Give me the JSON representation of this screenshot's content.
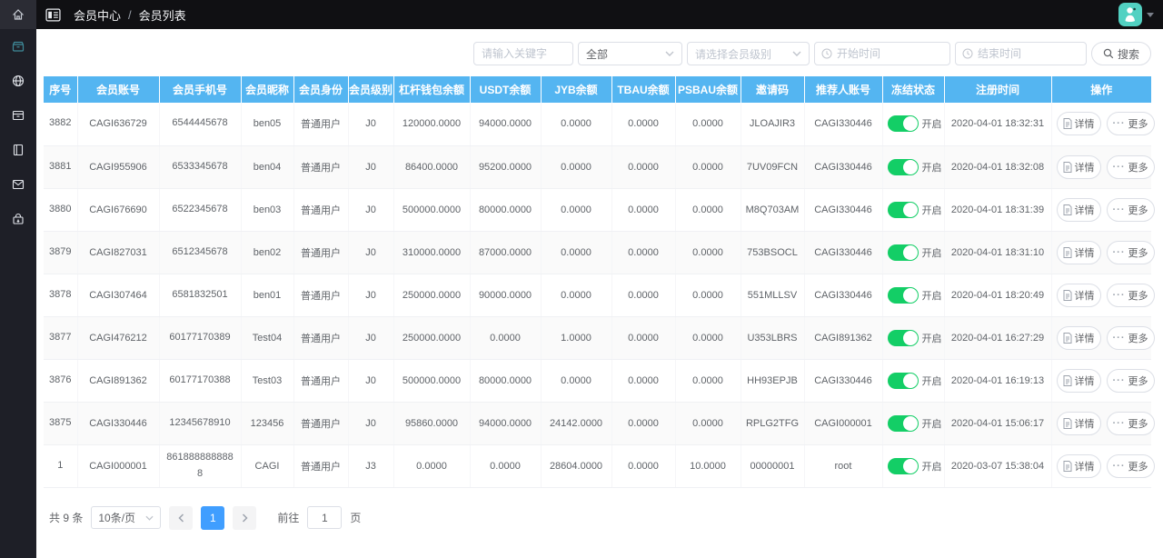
{
  "breadcrumb": {
    "section": "会员中心",
    "separator": "/",
    "current": "会员列表"
  },
  "sidebar": {
    "logo_icon": "home",
    "items": [
      {
        "icon": "member-box",
        "active": true
      },
      {
        "icon": "globe",
        "active": false
      },
      {
        "icon": "archive",
        "active": false
      },
      {
        "icon": "notebook",
        "active": false
      },
      {
        "icon": "mail",
        "active": false
      },
      {
        "icon": "package",
        "active": false
      }
    ]
  },
  "filters": {
    "keyword_placeholder": "请输入关键字",
    "scope_value": "全部",
    "level_placeholder": "请选择会员级别",
    "start_placeholder": "开始时间",
    "end_placeholder": "结束时间",
    "search_label": "搜索"
  },
  "table": {
    "headers": [
      "序号",
      "会员账号",
      "会员手机号",
      "会员昵称",
      "会员身份",
      "会员级别",
      "杠杆钱包余额",
      "USDT余额",
      "JYB余额",
      "TBAU余额",
      "PSBAU余额",
      "邀请码",
      "推荐人账号",
      "冻结状态",
      "注册时间",
      "操作"
    ],
    "actions": {
      "detail": "详情",
      "more": "更多"
    },
    "rows": [
      {
        "no": "3882",
        "account": "CAGI636729",
        "phone": "6544445678",
        "nickname": "ben05",
        "identity": "普通用户",
        "level": "J0",
        "wallet": "120000.0000",
        "usdt": "94000.0000",
        "jyb": "0.0000",
        "tbau": "0.0000",
        "psbau": "0.0000",
        "invite": "JLOAJIR3",
        "referrer": "CAGI330446",
        "freeze": "开启",
        "registered": "2020-04-01 18:32:31"
      },
      {
        "no": "3881",
        "account": "CAGI955906",
        "phone": "6533345678",
        "nickname": "ben04",
        "identity": "普通用户",
        "level": "J0",
        "wallet": "86400.0000",
        "usdt": "95200.0000",
        "jyb": "0.0000",
        "tbau": "0.0000",
        "psbau": "0.0000",
        "invite": "7UV09FCN",
        "referrer": "CAGI330446",
        "freeze": "开启",
        "registered": "2020-04-01 18:32:08"
      },
      {
        "no": "3880",
        "account": "CAGI676690",
        "phone": "6522345678",
        "nickname": "ben03",
        "identity": "普通用户",
        "level": "J0",
        "wallet": "500000.0000",
        "usdt": "80000.0000",
        "jyb": "0.0000",
        "tbau": "0.0000",
        "psbau": "0.0000",
        "invite": "M8Q703AM",
        "referrer": "CAGI330446",
        "freeze": "开启",
        "registered": "2020-04-01 18:31:39"
      },
      {
        "no": "3879",
        "account": "CAGI827031",
        "phone": "6512345678",
        "nickname": "ben02",
        "identity": "普通用户",
        "level": "J0",
        "wallet": "310000.0000",
        "usdt": "87000.0000",
        "jyb": "0.0000",
        "tbau": "0.0000",
        "psbau": "0.0000",
        "invite": "753BSOCL",
        "referrer": "CAGI330446",
        "freeze": "开启",
        "registered": "2020-04-01 18:31:10"
      },
      {
        "no": "3878",
        "account": "CAGI307464",
        "phone": "6581832501",
        "nickname": "ben01",
        "identity": "普通用户",
        "level": "J0",
        "wallet": "250000.0000",
        "usdt": "90000.0000",
        "jyb": "0.0000",
        "tbau": "0.0000",
        "psbau": "0.0000",
        "invite": "551MLLSV",
        "referrer": "CAGI330446",
        "freeze": "开启",
        "registered": "2020-04-01 18:20:49"
      },
      {
        "no": "3877",
        "account": "CAGI476212",
        "phone": "60177170389",
        "nickname": "Test04",
        "identity": "普通用户",
        "level": "J0",
        "wallet": "250000.0000",
        "usdt": "0.0000",
        "jyb": "1.0000",
        "tbau": "0.0000",
        "psbau": "0.0000",
        "invite": "U353LBRS",
        "referrer": "CAGI891362",
        "freeze": "开启",
        "registered": "2020-04-01 16:27:29"
      },
      {
        "no": "3876",
        "account": "CAGI891362",
        "phone": "60177170388",
        "nickname": "Test03",
        "identity": "普通用户",
        "level": "J0",
        "wallet": "500000.0000",
        "usdt": "80000.0000",
        "jyb": "0.0000",
        "tbau": "0.0000",
        "psbau": "0.0000",
        "invite": "HH93EPJB",
        "referrer": "CAGI330446",
        "freeze": "开启",
        "registered": "2020-04-01 16:19:13"
      },
      {
        "no": "3875",
        "account": "CAGI330446",
        "phone": "12345678910",
        "nickname": "123456",
        "identity": "普通用户",
        "level": "J0",
        "wallet": "95860.0000",
        "usdt": "94000.0000",
        "jyb": "24142.0000",
        "tbau": "0.0000",
        "psbau": "0.0000",
        "invite": "RPLG2TFG",
        "referrer": "CAGI000001",
        "freeze": "开启",
        "registered": "2020-04-01 15:06:17"
      },
      {
        "no": "1",
        "account": "CAGI000001",
        "phone": "8618888888888",
        "nickname": "CAGI",
        "identity": "普通用户",
        "level": "J3",
        "wallet": "0.0000",
        "usdt": "0.0000",
        "jyb": "28604.0000",
        "tbau": "0.0000",
        "psbau": "10.0000",
        "invite": "00000001",
        "referrer": "root",
        "freeze": "开启",
        "registered": "2020-03-07 15:38:04"
      }
    ]
  },
  "pagination": {
    "total": "共 9 条",
    "page_size": "10条/页",
    "current_page": "1",
    "goto_label": "前往",
    "goto_value": "1",
    "unit_label": "页"
  },
  "icons": {
    "ellipsis_glyph": "···",
    "names": [
      "home",
      "member-box",
      "globe",
      "archive",
      "notebook",
      "mail",
      "package",
      "collapse-menu",
      "clock",
      "search",
      "chevron-down",
      "document",
      "ellipsis",
      "chevron-left",
      "chevron-right",
      "avatar",
      "caret-down"
    ]
  },
  "colors": {
    "table_header_blue": "#54b5f1",
    "toggle_green": "#13ce66",
    "pagination_active_blue": "#409eff",
    "avatar_teal": "#52d1c2",
    "topbar_bg": "#101013",
    "sidebar_bg": "#1e1f27"
  }
}
